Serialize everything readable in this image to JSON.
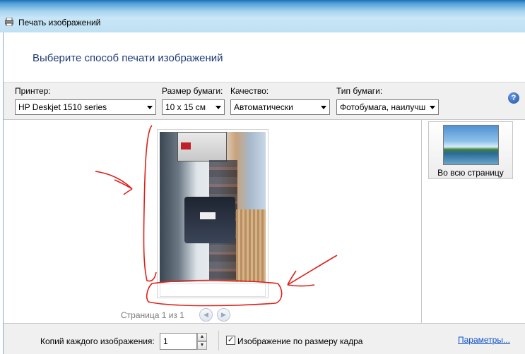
{
  "window": {
    "title": "Печать изображений"
  },
  "header": {
    "title": "Выберите способ печати изображений"
  },
  "toolbar": {
    "printer_label": "Принтер:",
    "printer_value": "HP Deskjet 1510 series",
    "paper_size_label": "Размер бумаги:",
    "paper_size_value": "10 x 15 см",
    "quality_label": "Качество:",
    "quality_value": "Автоматически",
    "paper_type_label": "Тип бумаги:",
    "paper_type_value": "Фотобумага, наилучш",
    "help_icon": "?"
  },
  "preview": {
    "page_indicator": "Страница 1 из 1",
    "prev_icon": "◀",
    "next_icon": "▶"
  },
  "layouts": [
    {
      "label": "Во всю страницу",
      "icon": "landscape-thumbnail-icon"
    }
  ],
  "bottom": {
    "copies_label": "Копий каждого изображения:",
    "copies_value": "1",
    "spin_up": "▲",
    "spin_down": "▼",
    "fit_checked": true,
    "fit_check_mark": "✓",
    "fit_label": "Изображение по размеру кадра",
    "params_link": "Параметры..."
  },
  "colors": {
    "header_title": "#1e3c78",
    "link": "#0b50c8",
    "annotation": "#e0201a"
  }
}
